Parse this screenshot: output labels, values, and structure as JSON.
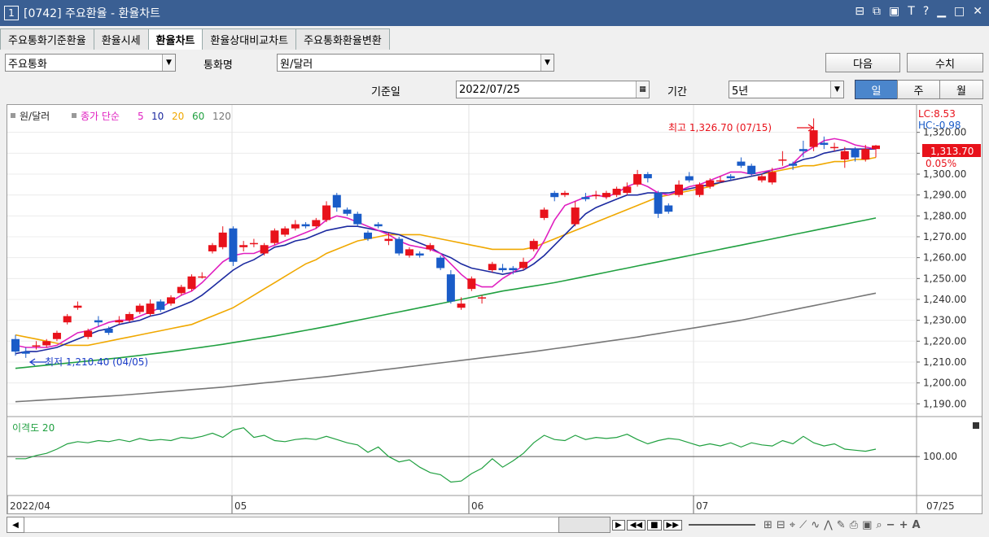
{
  "window": {
    "number": "1",
    "title": "[0742] 주요환율 - 환율차트"
  },
  "tabs": [
    "주요통화기준환율",
    "환율시세",
    "환율차트",
    "환율상대비교차트",
    "주요통화환율변환"
  ],
  "toolbar": {
    "currency_group": "주요통화",
    "currency_label": "통화명",
    "currency_value": "원/달러",
    "next_button": "다음",
    "value_button": "수치",
    "date_label": "기준일",
    "date_value": "2022/07/25",
    "period_label": "기간",
    "period_value": "5년",
    "period_day": "일",
    "period_week": "주",
    "period_month": "월"
  },
  "legend": {
    "name": "원/달러",
    "ma_label": "종가 단순",
    "ma_periods": [
      "5",
      "10",
      "20",
      "60",
      "120"
    ],
    "sub_label": "이격도 20"
  },
  "annotations": {
    "high": "최고 1,326.70 (07/15)",
    "low": "최저 1,210.40 (04/05)"
  },
  "indicators": {
    "lc": "LC:8.53",
    "hc": "HC:-0.98",
    "current": "1,313.70",
    "change": "0.05%"
  },
  "colors": {
    "up": "#e8121b",
    "down": "#1a5cc8",
    "ma5": "#e020c0",
    "ma10": "#1c2aa0",
    "ma20": "#f0a800",
    "ma60": "#20a040",
    "ma120": "#777777",
    "disparity": "#20a040"
  },
  "chart_data": {
    "type": "candlestick",
    "y_ticks": [
      "1,320.00",
      "1,310.00",
      "1,300.00",
      "1,290.00",
      "1,280.00",
      "1,270.00",
      "1,260.00",
      "1,250.00",
      "1,240.00",
      "1,230.00",
      "1,220.00",
      "1,210.00",
      "1,200.00",
      "1,190.00"
    ],
    "ylim": [
      1187,
      1330
    ],
    "sub_tick": "100.00",
    "x_labels": [
      "2022/04",
      "05",
      "06",
      "07",
      "07/25"
    ],
    "candles": [
      {
        "o": 1221,
        "c": 1215,
        "h": 1223,
        "l": 1213
      },
      {
        "o": 1215,
        "c": 1214,
        "h": 1217,
        "l": 1212
      },
      {
        "o": 1218,
        "c": 1218,
        "h": 1220,
        "l": 1216
      },
      {
        "o": 1218,
        "c": 1220,
        "h": 1221,
        "l": 1217
      },
      {
        "o": 1221,
        "c": 1224,
        "h": 1225,
        "l": 1220
      },
      {
        "o": 1229,
        "c": 1232,
        "h": 1233,
        "l": 1228
      },
      {
        "o": 1236,
        "c": 1237,
        "h": 1239,
        "l": 1235
      },
      {
        "o": 1222,
        "c": 1225,
        "h": 1226,
        "l": 1221
      },
      {
        "o": 1230,
        "c": 1229,
        "h": 1232,
        "l": 1227
      },
      {
        "o": 1226,
        "c": 1224,
        "h": 1227,
        "l": 1223
      },
      {
        "o": 1229,
        "c": 1230,
        "h": 1232,
        "l": 1228
      },
      {
        "o": 1230,
        "c": 1233,
        "h": 1234,
        "l": 1229
      },
      {
        "o": 1234,
        "c": 1237,
        "h": 1238,
        "l": 1233
      },
      {
        "o": 1233,
        "c": 1238,
        "h": 1240,
        "l": 1232
      },
      {
        "o": 1239,
        "c": 1235,
        "h": 1240,
        "l": 1234
      },
      {
        "o": 1238,
        "c": 1241,
        "h": 1242,
        "l": 1237
      },
      {
        "o": 1243,
        "c": 1246,
        "h": 1247,
        "l": 1242
      },
      {
        "o": 1245,
        "c": 1251,
        "h": 1252,
        "l": 1244
      },
      {
        "o": 1251,
        "c": 1251,
        "h": 1253,
        "l": 1250
      },
      {
        "o": 1263,
        "c": 1266,
        "h": 1267,
        "l": 1262
      },
      {
        "o": 1265,
        "c": 1272,
        "h": 1275,
        "l": 1264
      },
      {
        "o": 1274,
        "c": 1258,
        "h": 1275,
        "l": 1256
      },
      {
        "o": 1265,
        "c": 1266,
        "h": 1268,
        "l": 1263
      },
      {
        "o": 1267,
        "c": 1267,
        "h": 1269,
        "l": 1265
      },
      {
        "o": 1262,
        "c": 1266,
        "h": 1267,
        "l": 1261
      },
      {
        "o": 1267,
        "c": 1273,
        "h": 1274,
        "l": 1266
      },
      {
        "o": 1271,
        "c": 1274,
        "h": 1275,
        "l": 1270
      },
      {
        "o": 1274,
        "c": 1276,
        "h": 1278,
        "l": 1273
      },
      {
        "o": 1276,
        "c": 1275,
        "h": 1277,
        "l": 1274
      },
      {
        "o": 1275,
        "c": 1278,
        "h": 1279,
        "l": 1274
      },
      {
        "o": 1278,
        "c": 1285,
        "h": 1287,
        "l": 1277
      },
      {
        "o": 1290,
        "c": 1284,
        "h": 1291,
        "l": 1282
      },
      {
        "o": 1283,
        "c": 1281,
        "h": 1284,
        "l": 1280
      },
      {
        "o": 1281,
        "c": 1276,
        "h": 1282,
        "l": 1275
      },
      {
        "o": 1272,
        "c": 1269,
        "h": 1273,
        "l": 1268
      },
      {
        "o": 1276,
        "c": 1275,
        "h": 1277,
        "l": 1274
      },
      {
        "o": 1268,
        "c": 1269,
        "h": 1272,
        "l": 1266
      },
      {
        "o": 1269,
        "c": 1262,
        "h": 1270,
        "l": 1261
      },
      {
        "o": 1261,
        "c": 1264,
        "h": 1265,
        "l": 1260
      },
      {
        "o": 1262,
        "c": 1261,
        "h": 1263,
        "l": 1260
      },
      {
        "o": 1264,
        "c": 1266,
        "h": 1267,
        "l": 1263
      },
      {
        "o": 1260,
        "c": 1255,
        "h": 1261,
        "l": 1254
      },
      {
        "o": 1252,
        "c": 1239,
        "h": 1254,
        "l": 1238
      },
      {
        "o": 1236,
        "c": 1238,
        "h": 1241,
        "l": 1235
      },
      {
        "o": 1245,
        "c": 1250,
        "h": 1251,
        "l": 1244
      },
      {
        "o": 1241,
        "c": 1241,
        "h": 1242,
        "l": 1238
      },
      {
        "o": 1254,
        "c": 1257,
        "h": 1258,
        "l": 1253
      },
      {
        "o": 1255,
        "c": 1254,
        "h": 1257,
        "l": 1253
      },
      {
        "o": 1255,
        "c": 1254,
        "h": 1256,
        "l": 1252
      },
      {
        "o": 1255,
        "c": 1258,
        "h": 1260,
        "l": 1254
      },
      {
        "o": 1264,
        "c": 1268,
        "h": 1269,
        "l": 1263
      },
      {
        "o": 1279,
        "c": 1283,
        "h": 1284,
        "l": 1278
      },
      {
        "o": 1291,
        "c": 1289,
        "h": 1292,
        "l": 1287
      },
      {
        "o": 1290,
        "c": 1291,
        "h": 1292,
        "l": 1289
      },
      {
        "o": 1276,
        "c": 1284,
        "h": 1287,
        "l": 1275
      },
      {
        "o": 1289,
        "c": 1288,
        "h": 1291,
        "l": 1287
      },
      {
        "o": 1290,
        "c": 1290,
        "h": 1292,
        "l": 1288
      },
      {
        "o": 1289,
        "c": 1291,
        "h": 1292,
        "l": 1288
      },
      {
        "o": 1290,
        "c": 1293,
        "h": 1294,
        "l": 1289
      },
      {
        "o": 1291,
        "c": 1294,
        "h": 1296,
        "l": 1290
      },
      {
        "o": 1295,
        "c": 1300,
        "h": 1302,
        "l": 1294
      },
      {
        "o": 1300,
        "c": 1298,
        "h": 1301,
        "l": 1296
      },
      {
        "o": 1291,
        "c": 1281,
        "h": 1292,
        "l": 1279
      },
      {
        "o": 1285,
        "c": 1282,
        "h": 1286,
        "l": 1281
      },
      {
        "o": 1290,
        "c": 1295,
        "h": 1297,
        "l": 1289
      },
      {
        "o": 1299,
        "c": 1297,
        "h": 1301,
        "l": 1296
      },
      {
        "o": 1290,
        "c": 1295,
        "h": 1296,
        "l": 1289
      },
      {
        "o": 1294,
        "c": 1297,
        "h": 1298,
        "l": 1293
      },
      {
        "o": 1297,
        "c": 1297,
        "h": 1299,
        "l": 1296
      },
      {
        "o": 1299,
        "c": 1298,
        "h": 1300,
        "l": 1297
      },
      {
        "o": 1306,
        "c": 1304,
        "h": 1308,
        "l": 1303
      },
      {
        "o": 1304,
        "c": 1300,
        "h": 1305,
        "l": 1299
      },
      {
        "o": 1297,
        "c": 1299,
        "h": 1300,
        "l": 1296
      },
      {
        "o": 1296,
        "c": 1301,
        "h": 1303,
        "l": 1295
      },
      {
        "o": 1307,
        "c": 1307,
        "h": 1311,
        "l": 1304
      },
      {
        "o": 1305,
        "c": 1304,
        "h": 1306,
        "l": 1302
      },
      {
        "o": 1312,
        "c": 1311,
        "h": 1316,
        "l": 1308
      },
      {
        "o": 1313,
        "c": 1321,
        "h": 1326.7,
        "l": 1311
      },
      {
        "o": 1315,
        "c": 1314,
        "h": 1318,
        "l": 1312
      },
      {
        "o": 1313,
        "c": 1313,
        "h": 1315,
        "l": 1311
      },
      {
        "o": 1307,
        "c": 1311,
        "h": 1313,
        "l": 1303
      },
      {
        "o": 1312,
        "c": 1308,
        "h": 1313,
        "l": 1306
      },
      {
        "o": 1307,
        "c": 1312,
        "h": 1314,
        "l": 1306
      },
      {
        "o": 1312,
        "c": 1313.7,
        "h": 1314,
        "l": 1308
      }
    ],
    "ma5": [
      1218,
      1217,
      1217,
      1217,
      1218,
      1221,
      1224,
      1225,
      1227,
      1229,
      1230,
      1230,
      1232,
      1234,
      1236,
      1239,
      1242,
      1244,
      1248,
      1253,
      1258,
      1261,
      1262,
      1262,
      1264,
      1266,
      1268,
      1270,
      1272,
      1274,
      1278,
      1280,
      1279,
      1277,
      1275,
      1273,
      1271,
      1268,
      1266,
      1265,
      1264,
      1262,
      1257,
      1252,
      1248,
      1246,
      1246,
      1250,
      1253,
      1256,
      1260,
      1268,
      1278,
      1285,
      1287,
      1289,
      1290,
      1289,
      1291,
      1294,
      1296,
      1294,
      1291,
      1290,
      1292,
      1294,
      1295,
      1297,
      1299,
      1301,
      1301,
      1300,
      1301,
      1302,
      1303,
      1305,
      1310,
      1313,
      1316,
      1317,
      1316,
      1314,
      1313,
      1312
    ],
    "ma10": [
      1214,
      1215,
      1215,
      1216,
      1217,
      1219,
      1221,
      1223,
      1225,
      1226,
      1228,
      1229,
      1230,
      1232,
      1233,
      1235,
      1237,
      1239,
      1242,
      1246,
      1250,
      1254,
      1257,
      1259,
      1262,
      1265,
      1266,
      1268,
      1269,
      1271,
      1273,
      1274,
      1275,
      1275,
      1274,
      1273,
      1272,
      1271,
      1269,
      1267,
      1265,
      1262,
      1260,
      1257,
      1255,
      1254,
      1253,
      1252,
      1253,
      1254,
      1257,
      1261,
      1266,
      1271,
      1276,
      1281,
      1284,
      1286,
      1288,
      1290,
      1290,
      1291,
      1291,
      1291,
      1292,
      1293,
      1294,
      1295,
      1296,
      1297,
      1298,
      1299,
      1300,
      1302,
      1303,
      1305,
      1307,
      1308,
      1310,
      1311,
      1312,
      1312,
      1312,
      1312
    ],
    "ma20": [
      1223,
      1222,
      1221,
      1220,
      1219,
      1218,
      1218,
      1218,
      1219,
      1220,
      1221,
      1222,
      1223,
      1224,
      1225,
      1226,
      1227,
      1228,
      1230,
      1232,
      1234,
      1236,
      1239,
      1242,
      1245,
      1248,
      1251,
      1254,
      1257,
      1259,
      1262,
      1264,
      1266,
      1268,
      1269,
      1270,
      1271,
      1271,
      1271,
      1271,
      1270,
      1269,
      1268,
      1267,
      1266,
      1265,
      1264,
      1264,
      1264,
      1264,
      1265,
      1267,
      1269,
      1271,
      1273,
      1275,
      1277,
      1279,
      1281,
      1283,
      1285,
      1287,
      1289,
      1290,
      1291,
      1292,
      1293,
      1294,
      1296,
      1297,
      1298,
      1299,
      1300,
      1301,
      1302,
      1303,
      1304,
      1304,
      1305,
      1306,
      1306,
      1307,
      1307,
      1308
    ],
    "ma60": [
      1207,
      1207.5,
      1208,
      1208.5,
      1209,
      1209.5,
      1210,
      1210.5,
      1211,
      1211.5,
      1212,
      1212.6,
      1213.2,
      1213.8,
      1214.4,
      1215,
      1215.7,
      1216.4,
      1217.1,
      1217.8,
      1218.5,
      1219.3,
      1220.1,
      1220.9,
      1221.7,
      1222.5,
      1223.4,
      1224.3,
      1225.2,
      1226.1,
      1227,
      1228,
      1229,
      1230,
      1231,
      1232,
      1233,
      1234,
      1235,
      1236,
      1237,
      1238,
      1239,
      1240,
      1241,
      1242,
      1243,
      1244,
      1244.8,
      1245.6,
      1246.4,
      1247.2,
      1248,
      1249,
      1250,
      1251,
      1252,
      1253,
      1254,
      1255,
      1256,
      1257,
      1258,
      1259,
      1260,
      1261,
      1262,
      1263,
      1264,
      1265,
      1266,
      1267,
      1268,
      1269,
      1270,
      1271,
      1272,
      1273,
      1274,
      1275,
      1276,
      1277,
      1278,
      1279
    ],
    "ma120": [
      1191,
      1191.3,
      1191.6,
      1191.9,
      1192.2,
      1192.5,
      1192.8,
      1193.1,
      1193.4,
      1193.7,
      1194,
      1194.4,
      1194.8,
      1195.2,
      1195.6,
      1196,
      1196.4,
      1196.8,
      1197.2,
      1197.6,
      1198,
      1198.5,
      1199,
      1199.5,
      1200,
      1200.5,
      1201,
      1201.5,
      1202,
      1202.5,
      1203,
      1203.6,
      1204.2,
      1204.8,
      1205.4,
      1206,
      1206.6,
      1207.2,
      1207.8,
      1208.4,
      1209,
      1209.6,
      1210.2,
      1210.8,
      1211.4,
      1212,
      1212.6,
      1213.2,
      1213.8,
      1214.4,
      1215,
      1215.7,
      1216.4,
      1217.1,
      1217.8,
      1218.5,
      1219.2,
      1219.9,
      1220.6,
      1221.3,
      1222,
      1222.8,
      1223.6,
      1224.4,
      1225.2,
      1226,
      1226.8,
      1227.6,
      1228.4,
      1229.2,
      1230,
      1231,
      1232,
      1233,
      1234,
      1235,
      1236,
      1237,
      1238,
      1239,
      1240,
      1241,
      1242,
      1243
    ],
    "disparity": [
      99.8,
      99.8,
      100.1,
      100.3,
      100.7,
      101.2,
      101.4,
      101.3,
      101.5,
      101.4,
      101.6,
      101.4,
      101.7,
      101.5,
      101.6,
      101.5,
      101.8,
      101.7,
      101.9,
      102.2,
      101.8,
      102.5,
      102.7,
      101.8,
      102.0,
      101.5,
      101.4,
      101.6,
      101.7,
      101.6,
      101.9,
      101.6,
      101.3,
      101.1,
      100.4,
      100.9,
      100.0,
      99.5,
      99.7,
      99.0,
      98.5,
      98.3,
      97.6,
      97.7,
      98.4,
      98.9,
      99.8,
      99.0,
      99.6,
      100.3,
      101.3,
      102.0,
      101.6,
      101.5,
      102.0,
      101.6,
      101.8,
      101.7,
      101.8,
      102.1,
      101.6,
      101.2,
      101.5,
      101.7,
      101.6,
      101.3,
      101.0,
      101.2,
      101.0,
      101.3,
      100.9,
      101.3,
      101.1,
      101.0,
      101.5,
      101.2,
      101.9,
      101.3,
      101.0,
      101.2,
      100.7,
      100.6,
      100.5,
      100.7
    ]
  }
}
